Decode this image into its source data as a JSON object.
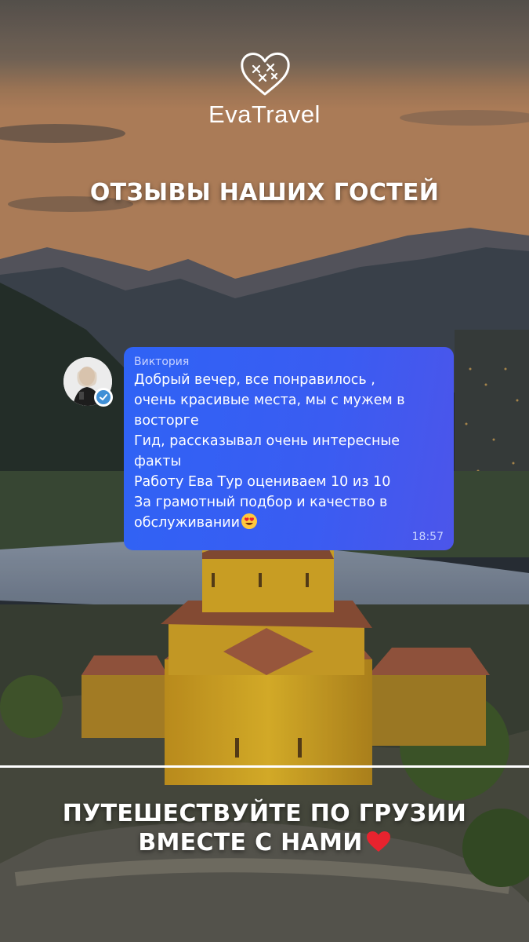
{
  "brand": {
    "name": "EvaTravel"
  },
  "headline": "ОТЗЫВЫ НАШИХ ГОСТЕЙ",
  "review": {
    "author": "Виктория",
    "lines": [
      "Добрый вечер, все понравилось ,",
      "очень красивые места, мы с мужем в",
      "восторге",
      "Гид, рассказывал очень интересные",
      "факты",
      "Работу Ева Тур оцениваем 10 из 10",
      "За грамотный подбор и качество в",
      "обслуживании"
    ],
    "time": "18:57",
    "emoji": "heart-eyes-emoji"
  },
  "cta": {
    "line1": "ПУТЕШЕСТВУЙТЕ ПО ГРУЗИИ",
    "line2": "ВМЕСТЕ С НАМИ"
  },
  "colors": {
    "bubble": "#3a5cf2",
    "heart": "#e8232e",
    "text": "#ffffff"
  }
}
